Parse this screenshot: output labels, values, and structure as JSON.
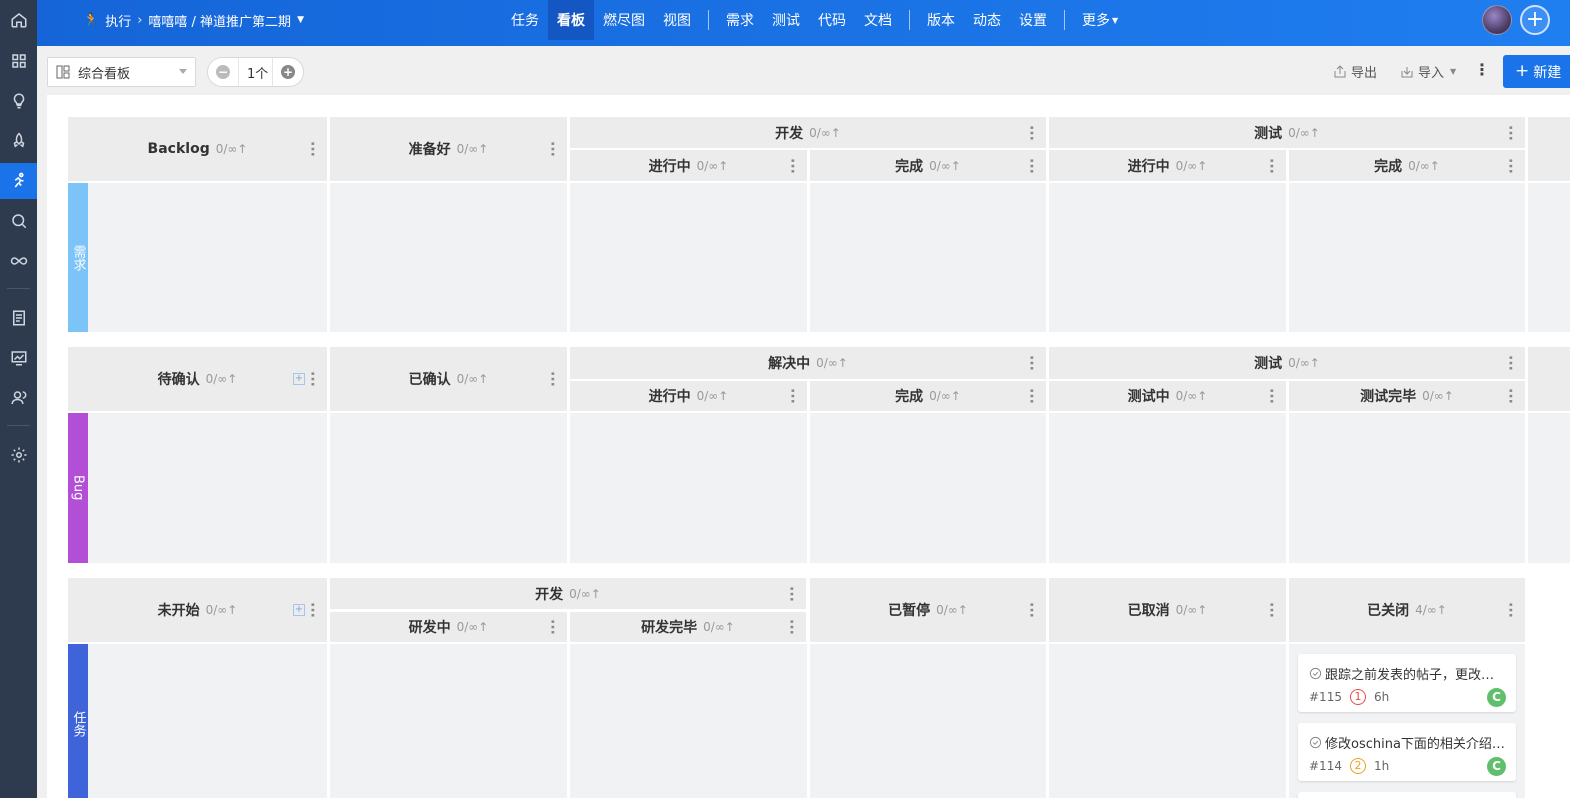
{
  "sidebar": {
    "items": [
      {
        "name": "home-icon"
      },
      {
        "name": "grid-icon"
      },
      {
        "name": "lightbulb-icon"
      },
      {
        "name": "rocket-icon"
      },
      {
        "name": "runner-icon",
        "active": true
      },
      {
        "name": "search-bug-icon"
      },
      {
        "name": "infinity-icon"
      },
      {
        "name": "list-doc-icon"
      },
      {
        "name": "monitor-chart-icon"
      },
      {
        "name": "users-icon"
      },
      {
        "name": "gear-icon"
      }
    ]
  },
  "header": {
    "module": "执行",
    "breadcrumb": "嘻嘻嘻 / 禅道推广第二期",
    "nav": [
      "任务",
      "看板",
      "燃尽图",
      "视图",
      "需求",
      "测试",
      "代码",
      "文档",
      "版本",
      "动态",
      "设置",
      "更多"
    ],
    "active_nav": "看板"
  },
  "toolbar": {
    "board_select": "综合看板",
    "stepper_value": "1个",
    "export_label": "导出",
    "import_label": "导入",
    "new_label": "新建"
  },
  "board": {
    "count_default": "0/∞",
    "lanes": [
      {
        "tag": "需求",
        "color": "#7cc3f7",
        "columns": {
          "c1": {
            "title": "Backlog",
            "count": "0/∞"
          },
          "c2": {
            "title": "准备好",
            "count": "0/∞"
          },
          "g1": {
            "title": "开发",
            "count": "0/∞"
          },
          "g1a": {
            "title": "进行中",
            "count": "0/∞"
          },
          "g1b": {
            "title": "完成",
            "count": "0/∞"
          },
          "g2": {
            "title": "测试",
            "count": "0/∞"
          },
          "g2a": {
            "title": "进行中",
            "count": "0/∞"
          },
          "g2b": {
            "title": "完成",
            "count": "0/∞"
          }
        }
      },
      {
        "tag": "Bug",
        "color": "#b34fd6",
        "columns": {
          "c1": {
            "title": "待确认",
            "count": "0/∞"
          },
          "c2": {
            "title": "已确认",
            "count": "0/∞"
          },
          "g1": {
            "title": "解决中",
            "count": "0/∞"
          },
          "g1a": {
            "title": "进行中",
            "count": "0/∞"
          },
          "g1b": {
            "title": "完成",
            "count": "0/∞"
          },
          "g2": {
            "title": "测试",
            "count": "0/∞"
          },
          "g2a": {
            "title": "测试中",
            "count": "0/∞"
          },
          "g2b": {
            "title": "测试完毕",
            "count": "0/∞"
          }
        }
      },
      {
        "tag": "任务",
        "color": "#3f63d8",
        "columns": {
          "c1": {
            "title": "未开始",
            "count": "0/∞"
          },
          "g1": {
            "title": "开发",
            "count": "0/∞"
          },
          "g1a": {
            "title": "研发中",
            "count": "0/∞"
          },
          "g1b": {
            "title": "研发完毕",
            "count": "0/∞"
          },
          "c3": {
            "title": "已暂停",
            "count": "0/∞"
          },
          "c4": {
            "title": "已取消",
            "count": "0/∞"
          },
          "c5": {
            "title": "已关闭",
            "count": "4/∞"
          }
        }
      }
    ],
    "cards": [
      {
        "title": "跟踪之前发表的帖子，更改…",
        "id": "#115",
        "priority": "1",
        "estimate": "6h",
        "owner": "C"
      },
      {
        "title": "修改oschina下面的相关介绍…",
        "id": "#114",
        "priority": "2",
        "estimate": "1h",
        "owner": "C"
      }
    ]
  }
}
